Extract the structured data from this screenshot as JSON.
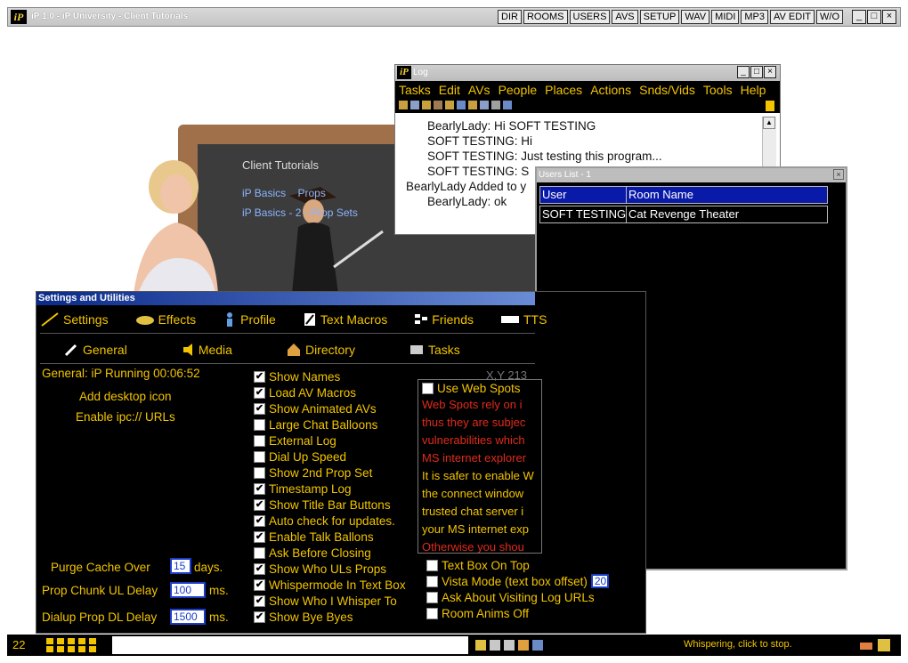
{
  "main": {
    "title": "iP 1.0 - iP University - Client Tutorials",
    "logo": "iP",
    "toolbar": [
      "DIR",
      "ROOMS",
      "USERS",
      "AVS",
      "SETUP",
      "WAV",
      "MIDI",
      "MP3",
      "AV EDIT",
      "W/O"
    ],
    "window_controls": [
      "_",
      "□",
      "×"
    ]
  },
  "art": {
    "heading": "Client Tutorials",
    "line1": "iP Basics    Props",
    "line2": "iP Basics - 2 - Prop Sets"
  },
  "log": {
    "title": "Log",
    "menu": [
      "Tasks",
      "Edit",
      "AVs",
      "People",
      "Places",
      "Actions",
      "Snds/Vids",
      "Tools",
      "Help"
    ],
    "lines": [
      "BearlyLady: Hi SOFT TESTING",
      "SOFT TESTING: Hi",
      "SOFT TESTING: Just testing this program...",
      "SOFT TESTING: S",
      "BearlyLady Added to y",
      "BearlyLady: ok"
    ]
  },
  "users_list": {
    "title": "Users List - 1",
    "columns": [
      "User",
      "Room Name"
    ],
    "rows": [
      [
        "SOFT TESTING",
        "Cat Revenge Theater"
      ]
    ]
  },
  "settings": {
    "title": "Settings and Utilities",
    "tabs_top": [
      "Settings",
      "Effects",
      "Profile",
      "Text Macros",
      "Friends",
      "TTS"
    ],
    "tabs_sub": [
      "General",
      "Media",
      "Directory",
      "Tasks"
    ],
    "general_status": "General: iP Running 00:06:52",
    "add_icon": "Add desktop icon",
    "enable_ipc": "Enable ipc:// URLs",
    "xy": "X,Y 213",
    "checks": [
      {
        "label": "Show Names",
        "checked": true
      },
      {
        "label": "Load AV Macros",
        "checked": true
      },
      {
        "label": "Show Animated AVs",
        "checked": true
      },
      {
        "label": "Large Chat Balloons",
        "checked": false
      },
      {
        "label": "External Log",
        "checked": false
      },
      {
        "label": "Dial Up Speed",
        "checked": false
      },
      {
        "label": "Show 2nd Prop Set",
        "checked": false
      },
      {
        "label": "Timestamp Log",
        "checked": true
      },
      {
        "label": "Show Title Bar Buttons",
        "checked": true
      },
      {
        "label": "Auto check for updates.",
        "checked": true
      },
      {
        "label": "Enable Talk Ballons",
        "checked": true
      },
      {
        "label": "Ask Before Closing",
        "checked": false
      },
      {
        "label": "Show Who ULs Props",
        "checked": true
      },
      {
        "label": "Whispermode In Text Box",
        "checked": true
      },
      {
        "label": "Show Who I Whisper To",
        "checked": true
      },
      {
        "label": "Show Bye Byes",
        "checked": true
      }
    ],
    "web_spots": {
      "label": "Use Web Spots",
      "checked": false,
      "red_lines": [
        "Web Spots rely on i",
        "thus they are subjec",
        "vulnerabilities which",
        "MS internet explorer"
      ],
      "yellow_lines": [
        "It is safer to enable W",
        "the connect window",
        "trusted chat server i",
        "your MS internet exp"
      ],
      "last_red": "Otherwise you shou"
    },
    "bottom_checks": [
      {
        "label": "Text Box On Top",
        "checked": false
      },
      {
        "label": "Vista Mode (text box offset)",
        "checked": false,
        "value": "20"
      },
      {
        "label": "Ask About Visiting Log URLs",
        "checked": false
      },
      {
        "label": "Room Anims Off",
        "checked": false
      }
    ],
    "purge_label": "Purge Cache Over",
    "purge_value": "15",
    "purge_unit": "days.",
    "ul_label": "Prop Chunk UL Delay",
    "ul_value": "100",
    "ul_unit": "ms.",
    "dl_label": "Dialup Prop DL Delay",
    "dl_value": "1500",
    "dl_unit": "ms."
  },
  "status": {
    "count": "22",
    "message": "Whispering, click to stop."
  }
}
